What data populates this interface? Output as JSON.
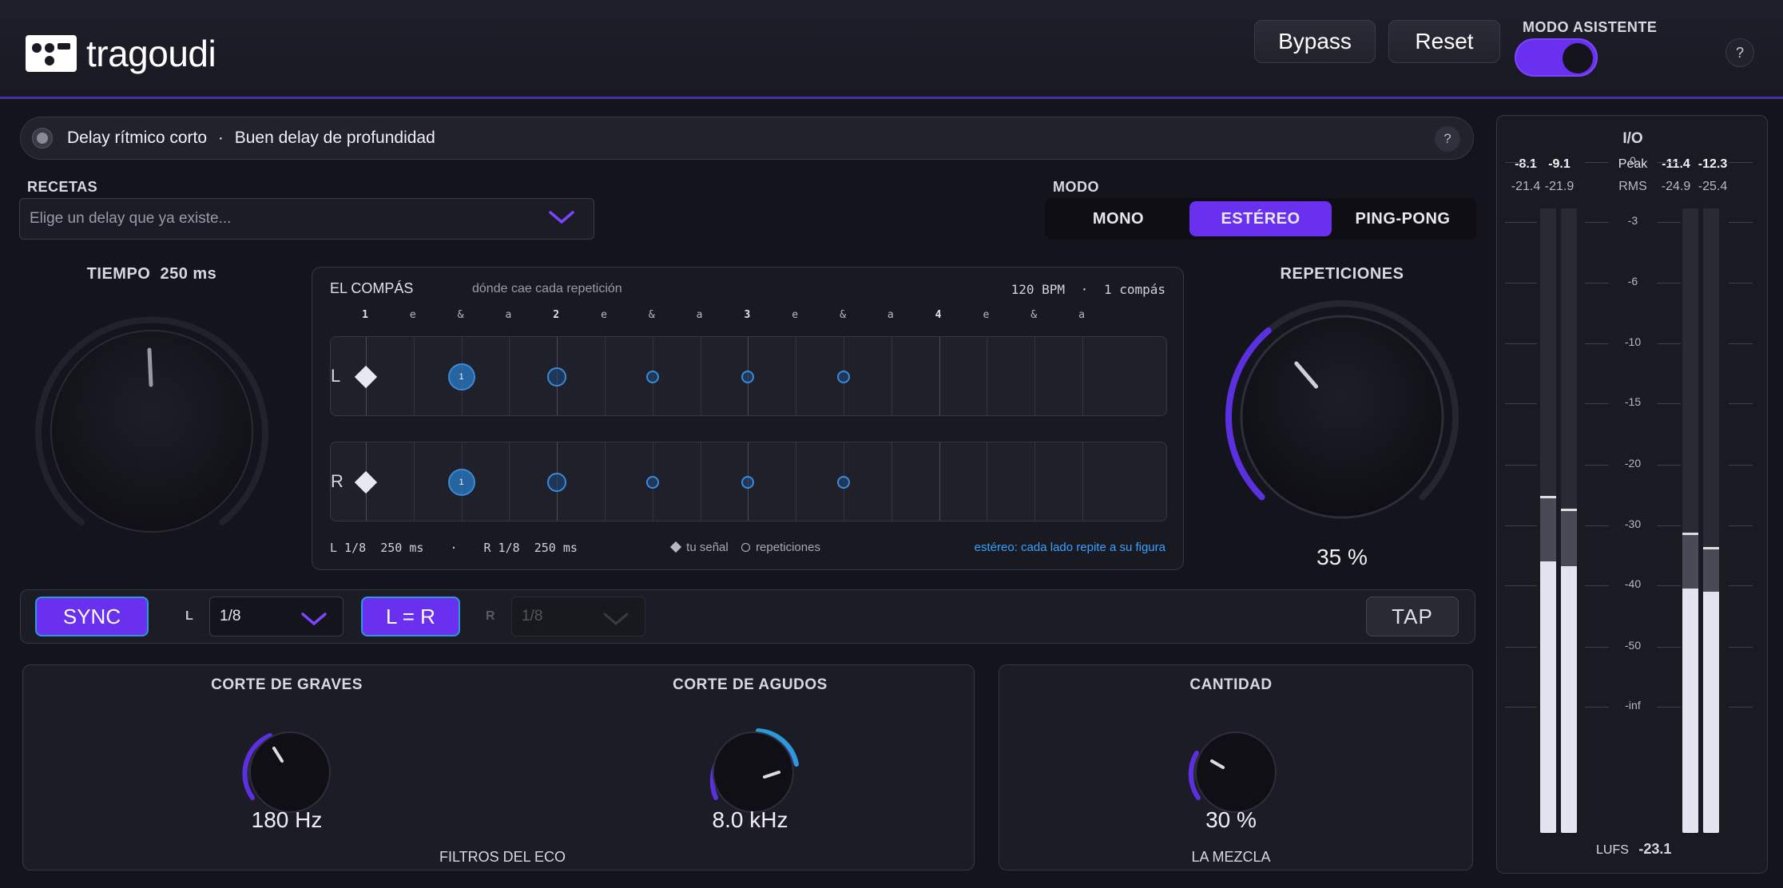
{
  "header": {
    "brand": "tragoudi",
    "bypass_label": "Bypass",
    "reset_label": "Reset",
    "assist_label": "MODO ASISTENTE",
    "assist_on": true,
    "help": "?"
  },
  "preset": {
    "name": "Delay rítmico corto",
    "separator": "·",
    "description": "Buen delay de profundidad",
    "help": "?"
  },
  "recipes": {
    "label": "RECETAS",
    "placeholder": "Elige un delay que ya existe..."
  },
  "mode": {
    "label": "MODO",
    "options": [
      "MONO",
      "ESTÉREO",
      "PING-PONG"
    ],
    "selected": "ESTÉREO"
  },
  "time": {
    "label": "TIEMPO",
    "value": "250 ms"
  },
  "compas": {
    "title": "EL COMPÁS",
    "subtitle": "dónde cae cada repetición",
    "bpm": "120 BPM",
    "sep": "·",
    "bars": "1 compás",
    "beat_labels": [
      "1",
      "e",
      "&",
      "a",
      "2",
      "e",
      "&",
      "a",
      "3",
      "e",
      "&",
      "a",
      "4",
      "e",
      "&",
      "a"
    ],
    "lanes": [
      "L",
      "R"
    ],
    "first_repeat_label": "1",
    "footer_l": "L 1/8  250 ms",
    "footer_sep": "·",
    "footer_r": "R 1/8  250 ms",
    "legend_signal": "tu señal",
    "legend_repeats": "repeticiones",
    "stereo_note": "estéreo: cada lado repite a su figura"
  },
  "repeats": {
    "label": "REPETICIONES",
    "value": "35 %",
    "level": 0.35
  },
  "sync_row": {
    "sync_label": "SYNC",
    "l_label": "L",
    "l_value": "1/8",
    "link_label": "L = R",
    "r_label": "R",
    "r_value": "1/8",
    "tap_label": "TAP"
  },
  "filters": {
    "low_cut_label": "CORTE DE GRAVES",
    "low_cut_value": "180 Hz",
    "high_cut_label": "CORTE DE AGUDOS",
    "high_cut_value": "8.0 kHz",
    "footer": "FILTROS DEL ECO"
  },
  "mix": {
    "amount_label": "CANTIDAD",
    "amount_value": "30 %",
    "footer": "LA MEZCLA"
  },
  "io": {
    "title": "I/O",
    "in_peak": [
      "-8.1",
      "-9.1"
    ],
    "in_rms": [
      "-21.4",
      "-21.9"
    ],
    "peak_label": "Peak",
    "rms_label": "RMS",
    "out_peak": [
      "-11.4",
      "-12.3"
    ],
    "out_rms": [
      "-24.9",
      "-25.4"
    ],
    "scale": [
      "0",
      "-3",
      "-6",
      "-10",
      "-15",
      "-20",
      "-30",
      "-40",
      "-50",
      "-inf"
    ],
    "lufs_label": "LUFS",
    "lufs_value": "-23.1"
  },
  "colors": {
    "accent": "#6a30f0",
    "repeat_blue": "#3a8ad8",
    "note_blue": "#3aa0ff"
  }
}
